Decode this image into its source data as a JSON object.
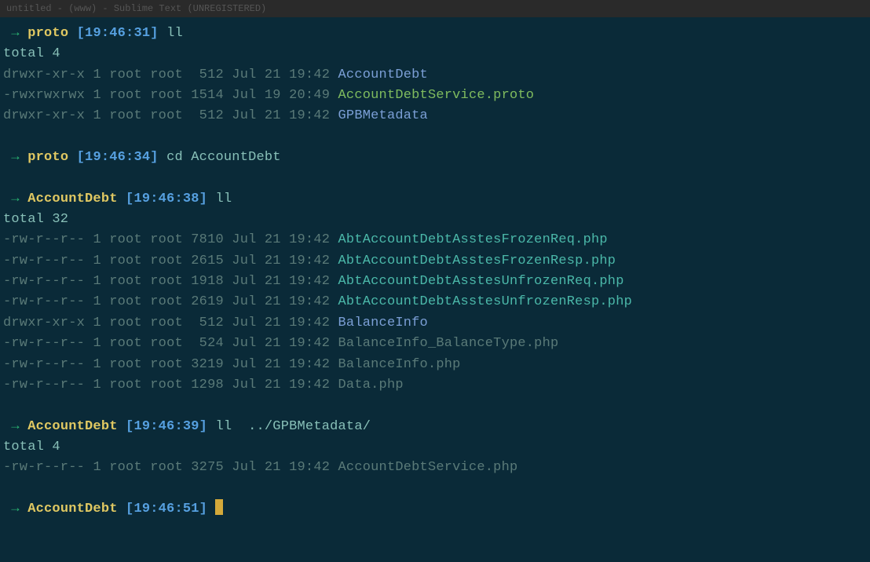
{
  "titlebar": "untitled - (www) - Sublime Text (UNREGISTERED)",
  "b1": {
    "arrow": " → ",
    "dir": "proto",
    "time": "[19:46:31]",
    "cmd": "ll",
    "total": "total 4",
    "rows": [
      {
        "perm": "drwxr-xr-x",
        "links": "1",
        "owner": "root",
        "group": "root",
        "size": " 512",
        "date": "Jul 21 19:42",
        "name": "AccountDebt",
        "cls": "file-dir"
      },
      {
        "perm": "-rwxrwxrwx",
        "links": "1",
        "owner": "root",
        "group": "root",
        "size": "1514",
        "date": "Jul 19 20:49",
        "name": "AccountDebtService.proto",
        "cls": "file-exec"
      },
      {
        "perm": "drwxr-xr-x",
        "links": "1",
        "owner": "root",
        "group": "root",
        "size": " 512",
        "date": "Jul 21 19:42",
        "name": "GPBMetadata",
        "cls": "file-dir"
      }
    ]
  },
  "b2": {
    "arrow": " → ",
    "dir": "proto",
    "time": "[19:46:34]",
    "cmd": "cd AccountDebt"
  },
  "b3": {
    "arrow": " → ",
    "dir": "AccountDebt",
    "time": "[19:46:38]",
    "cmd": "ll",
    "total": "total 32",
    "rows": [
      {
        "perm": "-rw-r--r--",
        "links": "1",
        "owner": "root",
        "group": "root",
        "size": "7810",
        "date": "Jul 21 19:42",
        "name": "AbtAccountDebtAsstesFrozenReq.php",
        "cls": "file-teal"
      },
      {
        "perm": "-rw-r--r--",
        "links": "1",
        "owner": "root",
        "group": "root",
        "size": "2615",
        "date": "Jul 21 19:42",
        "name": "AbtAccountDebtAsstesFrozenResp.php",
        "cls": "file-teal"
      },
      {
        "perm": "-rw-r--r--",
        "links": "1",
        "owner": "root",
        "group": "root",
        "size": "1918",
        "date": "Jul 21 19:42",
        "name": "AbtAccountDebtAsstesUnfrozenReq.php",
        "cls": "file-teal"
      },
      {
        "perm": "-rw-r--r--",
        "links": "1",
        "owner": "root",
        "group": "root",
        "size": "2619",
        "date": "Jul 21 19:42",
        "name": "AbtAccountDebtAsstesUnfrozenResp.php",
        "cls": "file-teal"
      },
      {
        "perm": "drwxr-xr-x",
        "links": "1",
        "owner": "root",
        "group": "root",
        "size": " 512",
        "date": "Jul 21 19:42",
        "name": "BalanceInfo",
        "cls": "file-dir"
      },
      {
        "perm": "-rw-r--r--",
        "links": "1",
        "owner": "root",
        "group": "root",
        "size": " 524",
        "date": "Jul 21 19:42",
        "name": "BalanceInfo_BalanceType.php",
        "cls": "dim"
      },
      {
        "perm": "-rw-r--r--",
        "links": "1",
        "owner": "root",
        "group": "root",
        "size": "3219",
        "date": "Jul 21 19:42",
        "name": "BalanceInfo.php",
        "cls": "dim"
      },
      {
        "perm": "-rw-r--r--",
        "links": "1",
        "owner": "root",
        "group": "root",
        "size": "1298",
        "date": "Jul 21 19:42",
        "name": "Data.php",
        "cls": "dim"
      }
    ]
  },
  "b4": {
    "arrow": " → ",
    "dir": "AccountDebt",
    "time": "[19:46:39]",
    "cmd": "ll ",
    "arg": " ../GPBMetadata/",
    "total": "total 4",
    "rows": [
      {
        "perm": "-rw-r--r--",
        "links": "1",
        "owner": "root",
        "group": "root",
        "size": "3275",
        "date": "Jul 21 19:42",
        "name": "AccountDebtService.php",
        "cls": "dim"
      }
    ]
  },
  "b5": {
    "arrow": " → ",
    "dir": "AccountDebt",
    "time": "[19:46:51]"
  }
}
